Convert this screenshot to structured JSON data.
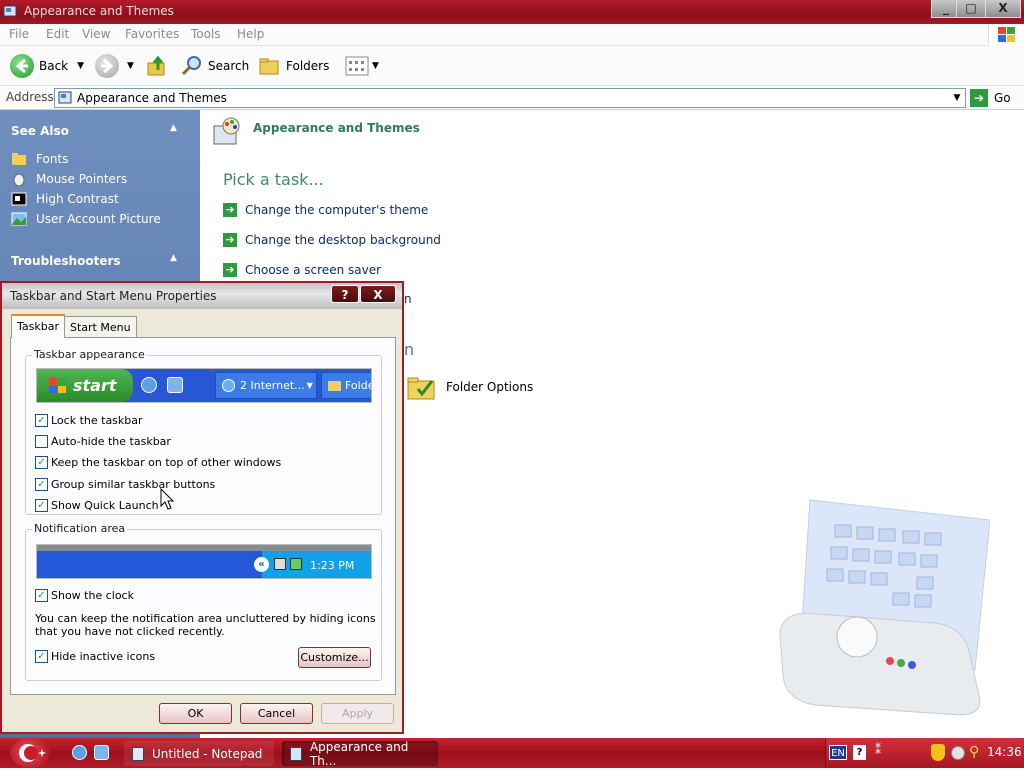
{
  "window": {
    "title": "Appearance and Themes",
    "controls": [
      "_",
      "□",
      "X"
    ]
  },
  "menu": [
    "File",
    "Edit",
    "View",
    "Favorites",
    "Tools",
    "Help"
  ],
  "toolbar": {
    "back": "Back",
    "search": "Search",
    "folders": "Folders"
  },
  "address": {
    "label": "Address",
    "value": "Appearance and Themes",
    "go": "Go"
  },
  "left_pane": {
    "see_also": {
      "title": "See Also",
      "items": [
        "Fonts",
        "Mouse Pointers",
        "High Contrast",
        "User Account Picture"
      ]
    },
    "troubleshooters": {
      "title": "Troubleshooters"
    }
  },
  "main": {
    "category_title": "Appearance and Themes",
    "pick_task": "Pick a task...",
    "tasks": [
      "Change the computer's theme",
      "Change the desktop background",
      "Choose a screen saver"
    ],
    "partial_text_1": "n",
    "partial_text_2": "n",
    "icon_label": "Folder Options"
  },
  "dialog": {
    "title": "Taskbar and Start Menu Properties",
    "help": "?",
    "close": "X",
    "tabs": [
      "Taskbar",
      "Start Menu"
    ],
    "appearance_group": "Taskbar appearance",
    "preview": {
      "start": "start",
      "internet": "2 Internet...",
      "folder": "Folde"
    },
    "options": [
      {
        "label": "Lock the taskbar",
        "checked": true
      },
      {
        "label": "Auto-hide the taskbar",
        "checked": false
      },
      {
        "label": "Keep the taskbar on top of other windows",
        "checked": true
      },
      {
        "label": "Group similar taskbar buttons",
        "checked": true
      },
      {
        "label": "Show Quick Launch",
        "checked": true
      }
    ],
    "notification_group": "Notification area",
    "clock_preview": "1:23 PM",
    "show_clock": {
      "label": "Show the clock",
      "checked": true
    },
    "note": "You can keep the notification area uncluttered by hiding icons that you have not clicked recently.",
    "hide_inactive": {
      "label": "Hide inactive icons",
      "checked": true
    },
    "customize": "Customize...",
    "ok": "OK",
    "cancel": "Cancel",
    "apply": "Apply"
  },
  "taskbar": {
    "items": [
      "Untitled - Notepad",
      "Appearance and Th..."
    ],
    "lang": "EN",
    "clock": "14:36"
  },
  "colors": {
    "title_red": "#a01826",
    "pane_blue": "#5f7fb2",
    "link_green": "#2f7b5f",
    "taskbar_red": "#b01a27"
  }
}
